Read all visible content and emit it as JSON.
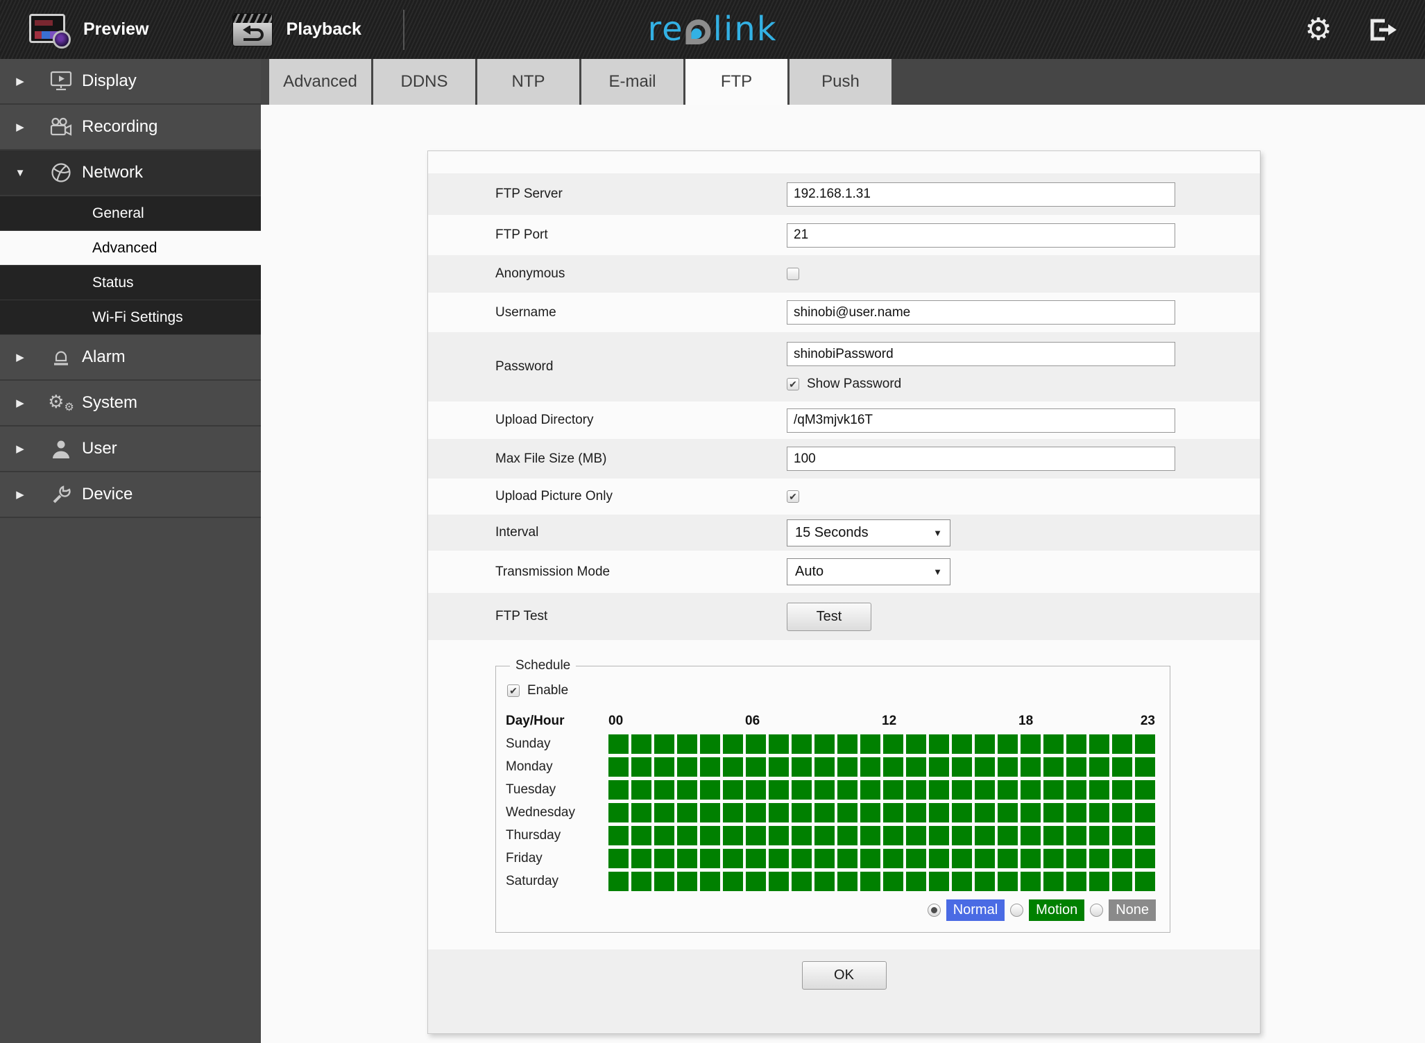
{
  "colors": {
    "accent_blue": "#33b1e4",
    "schedule_green": "#008000",
    "normal_blue": "#4a6be4",
    "motion_green": "#008000",
    "none_gray": "#8a8a8a"
  },
  "topbar": {
    "preview_label": "Preview",
    "playback_label": "Playback",
    "logo_re": "re",
    "logo_link": "link"
  },
  "sidebar": {
    "items": [
      {
        "label": "Display"
      },
      {
        "label": "Recording"
      },
      {
        "label": "Network"
      },
      {
        "label": "Alarm"
      },
      {
        "label": "System"
      },
      {
        "label": "User"
      },
      {
        "label": "Device"
      }
    ],
    "network_children": [
      {
        "label": "General"
      },
      {
        "label": "Advanced",
        "selected": true
      },
      {
        "label": "Status"
      },
      {
        "label": "Wi-Fi Settings"
      }
    ]
  },
  "tabs": {
    "items": [
      {
        "label": "Advanced"
      },
      {
        "label": "DDNS"
      },
      {
        "label": "NTP"
      },
      {
        "label": "E-mail"
      },
      {
        "label": "FTP",
        "active": true
      },
      {
        "label": "Push"
      }
    ]
  },
  "form": {
    "ftp_server": {
      "label": "FTP Server",
      "value": "192.168.1.31"
    },
    "ftp_port": {
      "label": "FTP Port",
      "value": "21"
    },
    "anonymous": {
      "label": "Anonymous",
      "checked": false
    },
    "username": {
      "label": "Username",
      "value": "shinobi@user.name"
    },
    "password": {
      "label": "Password",
      "value": "shinobiPassword",
      "show_password_label": "Show Password",
      "show_password_checked": true
    },
    "upload_directory": {
      "label": "Upload Directory",
      "value": "/qM3mjvk16T"
    },
    "max_file_size": {
      "label": "Max File Size (MB)",
      "value": "100"
    },
    "upload_picture_only": {
      "label": "Upload Picture Only",
      "checked": true
    },
    "interval": {
      "label": "Interval",
      "value": "15 Seconds"
    },
    "transmission_mode": {
      "label": "Transmission Mode",
      "value": "Auto"
    },
    "ftp_test": {
      "label": "FTP Test",
      "button": "Test"
    }
  },
  "schedule": {
    "legend": "Schedule",
    "enable_label": "Enable",
    "enable_checked": true,
    "day_hour_label": "Day/Hour",
    "hours": [
      "00",
      "06",
      "12",
      "18",
      "23"
    ],
    "days": [
      "Sunday",
      "Monday",
      "Tuesday",
      "Wednesday",
      "Thursday",
      "Friday",
      "Saturday"
    ],
    "columns": 24,
    "all_cells": "motion",
    "brushes": [
      {
        "label": "Normal",
        "color": "#4a6be4",
        "selected": true
      },
      {
        "label": "Motion",
        "color": "#008000",
        "selected": false
      },
      {
        "label": "None",
        "color": "#8a8a8a",
        "selected": false
      }
    ]
  },
  "ok_label": "OK"
}
